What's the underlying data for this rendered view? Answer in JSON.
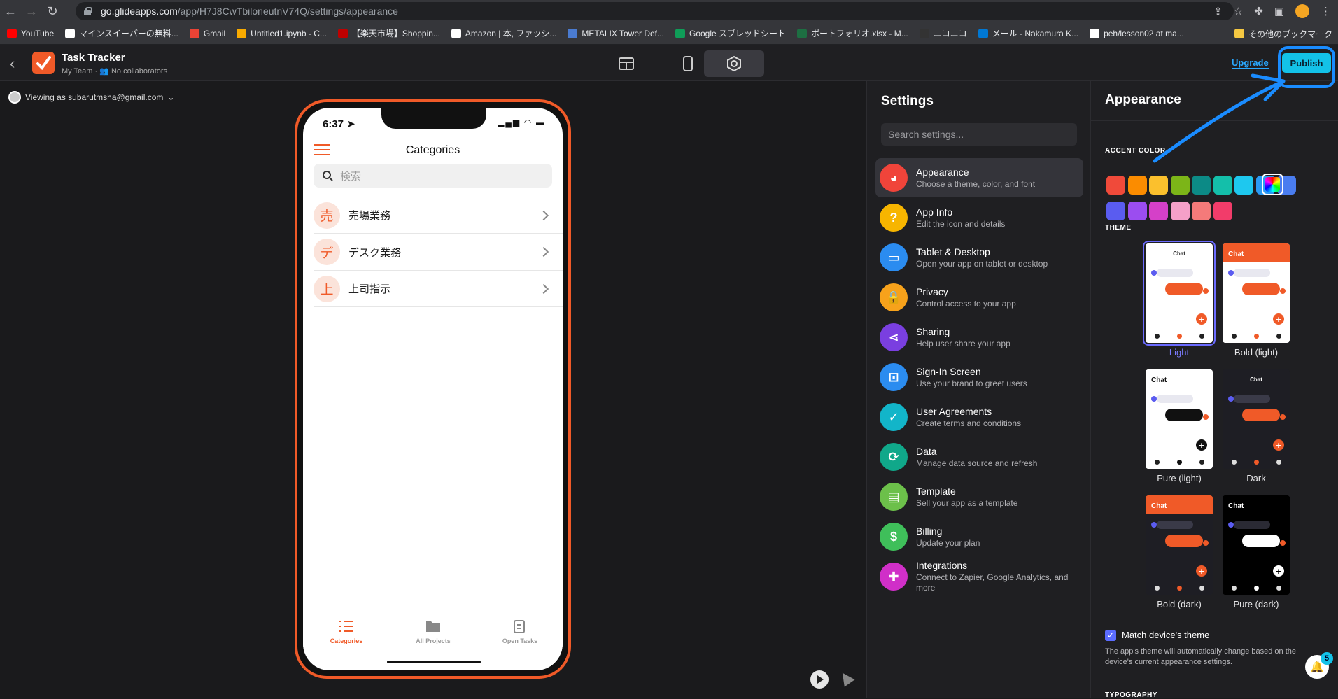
{
  "browser": {
    "url_host": "go.glideapps.com",
    "url_path": "/app/H7J8CwTbiloneutnV74Q/settings/appearance",
    "bookmarks": [
      {
        "label": "YouTube",
        "color": "#ff0000"
      },
      {
        "label": "マインスイーパーの無料...",
        "color": "#ffffff"
      },
      {
        "label": "Gmail",
        "color": "#ea4335"
      },
      {
        "label": "Untitled1.ipynb - C...",
        "color": "#f9ab00"
      },
      {
        "label": "【楽天市場】Shoppin...",
        "color": "#bf0000"
      },
      {
        "label": "Amazon | 本, ファッシ...",
        "color": "#ffffff"
      },
      {
        "label": "METALIX Tower Def...",
        "color": "#4a7bd0"
      },
      {
        "label": "Google スプレッドシート",
        "color": "#0f9d58"
      },
      {
        "label": "ポートフォリオ.xlsx - M...",
        "color": "#1d6f42"
      },
      {
        "label": "ニコニコ",
        "color": "#333333"
      },
      {
        "label": "メール - Nakamura K...",
        "color": "#0078d4"
      },
      {
        "label": "peh/lesson02 at ma...",
        "color": "#ffffff"
      }
    ],
    "bookmarks_more": "»",
    "other_bookmarks": "その他のブックマーク"
  },
  "header": {
    "app_title": "Task Tracker",
    "team": "My Team",
    "collaborators": "No collaborators",
    "upgrade": "Upgrade",
    "publish": "Publish"
  },
  "canvas": {
    "viewing_as": "Viewing as subarutmsha@gmail.com"
  },
  "phone": {
    "time": "6:37",
    "title": "Categories",
    "search_placeholder": "検索",
    "categories": [
      {
        "initial": "売",
        "label": "売場業務"
      },
      {
        "initial": "デ",
        "label": "デスク業務"
      },
      {
        "initial": "上",
        "label": "上司指示"
      }
    ],
    "tabs": [
      {
        "label": "Categories",
        "active": true
      },
      {
        "label": "All Projects",
        "active": false
      },
      {
        "label": "Open Tasks",
        "active": false
      }
    ]
  },
  "settings": {
    "title": "Settings",
    "search_placeholder": "Search settings...",
    "items": [
      {
        "name": "Appearance",
        "desc": "Choose a theme, color, and font",
        "color": "#f0443a",
        "icon": "palette-icon",
        "glyph": "◕"
      },
      {
        "name": "App Info",
        "desc": "Edit the icon and details",
        "color": "#f7b500",
        "icon": "question-icon",
        "glyph": "?"
      },
      {
        "name": "Tablet & Desktop",
        "desc": "Open your app on tablet or desktop",
        "color": "#2b8cf0",
        "icon": "tablet-icon",
        "glyph": "▭"
      },
      {
        "name": "Privacy",
        "desc": "Control access to your app",
        "color": "#f7a21b",
        "icon": "lock-icon",
        "glyph": "🔒"
      },
      {
        "name": "Sharing",
        "desc": "Help user share your app",
        "color": "#7a3fe0",
        "icon": "share-icon",
        "glyph": "⋖"
      },
      {
        "name": "Sign-In Screen",
        "desc": "Use your brand to greet users",
        "color": "#2b8cf0",
        "icon": "signin-icon",
        "glyph": "⊡"
      },
      {
        "name": "User Agreements",
        "desc": "Create terms and conditions",
        "color": "#12b5c9",
        "icon": "check-circle-icon",
        "glyph": "✓"
      },
      {
        "name": "Data",
        "desc": "Manage data source and refresh",
        "color": "#10a88a",
        "icon": "data-icon",
        "glyph": "⟳"
      },
      {
        "name": "Template",
        "desc": "Sell your app as a template",
        "color": "#6cc04a",
        "icon": "store-icon",
        "glyph": "▤"
      },
      {
        "name": "Billing",
        "desc": "Update your plan",
        "color": "#3fbf5a",
        "icon": "billing-icon",
        "glyph": "$"
      },
      {
        "name": "Integrations",
        "desc": "Connect to Zapier, Google Analytics, and more",
        "color": "#d02fc8",
        "icon": "puzzle-icon",
        "glyph": "✚"
      }
    ]
  },
  "appearance": {
    "title": "Appearance",
    "accent_label": "ACCENT COLOR",
    "accent_colors": [
      "#f04a3a",
      "#fb8c00",
      "#fbc02d",
      "#7cb518",
      "#0c8a86",
      "#14bfaa",
      "#1ec8ef",
      "#2b9bf4",
      "#4a7df0",
      "#5a5cf0",
      "#9b4df0",
      "#d540c8",
      "#f5a0c8",
      "#f47a7a",
      "#f23c6a"
    ],
    "theme_label": "THEME",
    "themes": [
      {
        "name": "Light",
        "selected": true,
        "header": "Chat",
        "bg": "#ffffff",
        "hdr_bg": "#ffffff",
        "hdr_fg": "#333333",
        "bubble1": "#e8e8f0",
        "bubble2": "#f05a28",
        "fab": "#f05a28"
      },
      {
        "name": "Bold (light)",
        "selected": false,
        "header": "Chat",
        "bg": "#ffffff",
        "hdr_bg": "#f05a28",
        "hdr_fg": "#ffffff",
        "bubble1": "#e8e8f0",
        "bubble2": "#f05a28",
        "fab": "#f05a28"
      },
      {
        "name": "Pure (light)",
        "selected": false,
        "header": "Chat",
        "bg": "#ffffff",
        "hdr_bg": "#ffffff",
        "hdr_fg": "#111111",
        "bubble1": "#e8e8f0",
        "bubble2": "#111111",
        "fab": "#111111"
      },
      {
        "name": "Dark",
        "selected": false,
        "header": "Chat",
        "bg": "#1e1e24",
        "hdr_bg": "#1e1e24",
        "hdr_fg": "#ffffff",
        "bubble1": "#3a3a48",
        "bubble2": "#f05a28",
        "fab": "#f05a28"
      },
      {
        "name": "Bold (dark)",
        "selected": false,
        "header": "Chat",
        "bg": "#1e1e24",
        "hdr_bg": "#f05a28",
        "hdr_fg": "#ffffff",
        "bubble1": "#3a3a48",
        "bubble2": "#f05a28",
        "fab": "#f05a28"
      },
      {
        "name": "Pure (dark)",
        "selected": false,
        "header": "Chat",
        "bg": "#000000",
        "hdr_bg": "#000000",
        "hdr_fg": "#ffffff",
        "bubble1": "#2a2a34",
        "bubble2": "#ffffff",
        "fab": "#ffffff"
      }
    ],
    "match_label": "Match device's theme",
    "match_desc": "The app's theme will automatically change based on the device's current appearance settings.",
    "typography_label": "TYPOGRAPHY",
    "notification_count": "5"
  }
}
